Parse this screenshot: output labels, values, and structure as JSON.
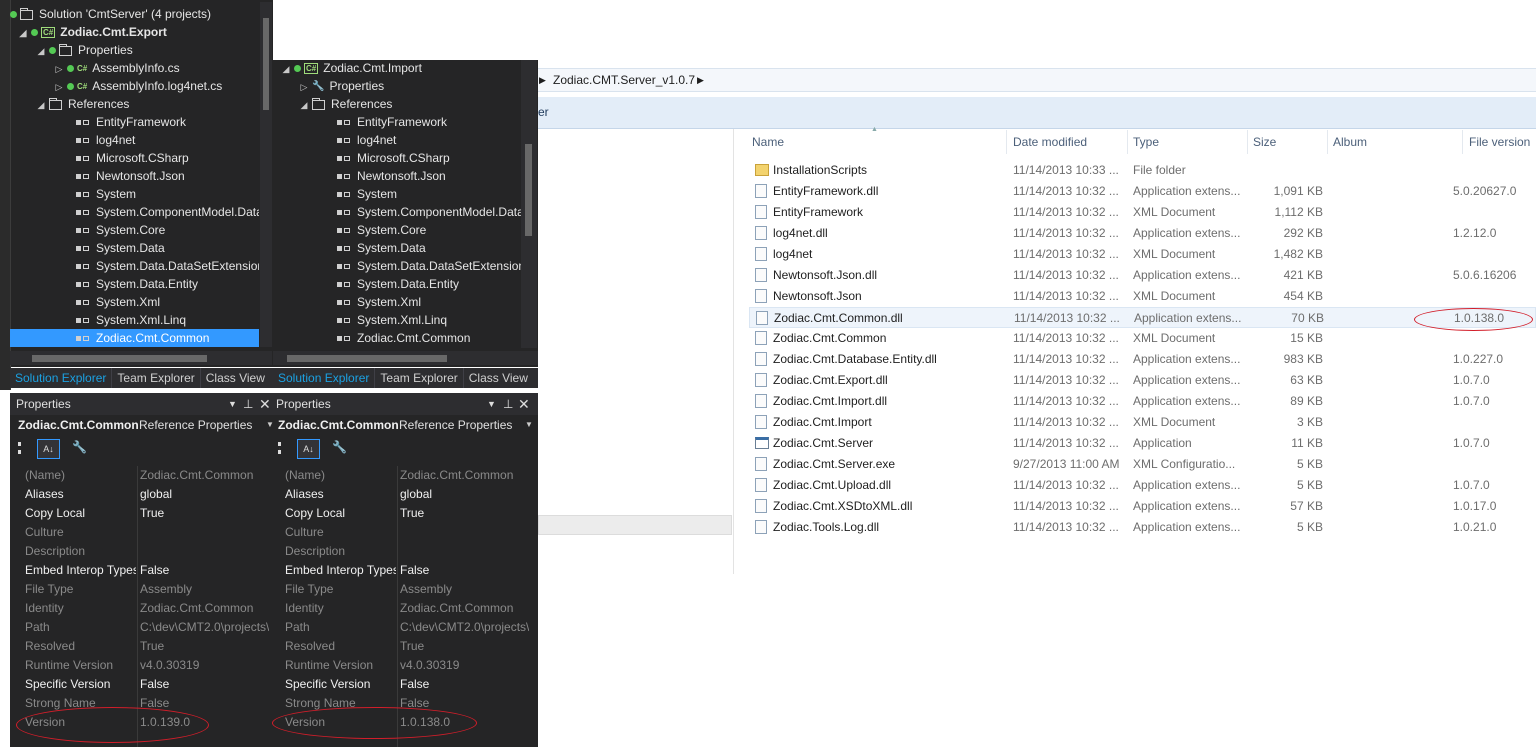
{
  "left_solution": {
    "rows": [
      {
        "text": "Solution 'CmtServer' (4 projects)",
        "icon": "solution-icon"
      },
      {
        "text": "Zodiac.Cmt.Export",
        "icon": "csharp-project-icon"
      },
      {
        "text": "Properties",
        "icon": "properties-folder-icon"
      },
      {
        "text": "AssemblyInfo.cs",
        "icon": "csharp-file-icon"
      },
      {
        "text": "AssemblyInfo.log4net.cs",
        "icon": "csharp-file-icon"
      },
      {
        "text": "References",
        "icon": "references-folder-icon"
      },
      {
        "text": "EntityFramework",
        "icon": "reference-icon"
      },
      {
        "text": "log4net",
        "icon": "reference-icon"
      },
      {
        "text": "Microsoft.CSharp",
        "icon": "reference-icon"
      },
      {
        "text": "Newtonsoft.Json",
        "icon": "reference-icon"
      },
      {
        "text": "System",
        "icon": "reference-icon"
      },
      {
        "text": "System.ComponentModel.DataAnnotations",
        "icon": "reference-icon"
      },
      {
        "text": "System.Core",
        "icon": "reference-icon"
      },
      {
        "text": "System.Data",
        "icon": "reference-icon"
      },
      {
        "text": "System.Data.DataSetExtensions",
        "icon": "reference-icon"
      },
      {
        "text": "System.Data.Entity",
        "icon": "reference-icon"
      },
      {
        "text": "System.Xml",
        "icon": "reference-icon"
      },
      {
        "text": "System.Xml.Linq",
        "icon": "reference-icon"
      },
      {
        "text": "Zodiac.Cmt.Common",
        "icon": "reference-icon"
      }
    ],
    "tabs": [
      "Solution Explorer",
      "Team Explorer",
      "Class View"
    ]
  },
  "right_solution": {
    "rows": [
      {
        "text": "Zodiac.Cmt.Import",
        "icon": "csharp-project-icon"
      },
      {
        "text": "Properties",
        "icon": "wrench-icon"
      },
      {
        "text": "References",
        "icon": "references-folder-icon"
      },
      {
        "text": "EntityFramework",
        "icon": "reference-icon"
      },
      {
        "text": "log4net",
        "icon": "reference-icon"
      },
      {
        "text": "Microsoft.CSharp",
        "icon": "reference-icon"
      },
      {
        "text": "Newtonsoft.Json",
        "icon": "reference-icon"
      },
      {
        "text": "System",
        "icon": "reference-icon"
      },
      {
        "text": "System.ComponentModel.DataAnnotations",
        "icon": "reference-icon"
      },
      {
        "text": "System.Core",
        "icon": "reference-icon"
      },
      {
        "text": "System.Data",
        "icon": "reference-icon"
      },
      {
        "text": "System.Data.DataSetExtensions",
        "icon": "reference-icon"
      },
      {
        "text": "System.Data.Entity",
        "icon": "reference-icon"
      },
      {
        "text": "System.Xml",
        "icon": "reference-icon"
      },
      {
        "text": "System.Xml.Linq",
        "icon": "reference-icon"
      },
      {
        "text": "Zodiac.Cmt.Common",
        "icon": "reference-icon"
      }
    ],
    "tabs": [
      "Solution Explorer",
      "Team Explorer",
      "Class View"
    ]
  },
  "left_props": {
    "title": "Properties",
    "object_name": "Zodiac.Cmt.Common",
    "object_type": "Reference Properties",
    "rows": [
      {
        "name": "(Name)",
        "value": "Zodiac.Cmt.Common",
        "enabled": false
      },
      {
        "name": "Aliases",
        "value": "global",
        "enabled": true
      },
      {
        "name": "Copy Local",
        "value": "True",
        "enabled": true
      },
      {
        "name": "Culture",
        "value": "",
        "enabled": false
      },
      {
        "name": "Description",
        "value": "",
        "enabled": false
      },
      {
        "name": "Embed Interop Types",
        "value": "False",
        "enabled": true
      },
      {
        "name": "File Type",
        "value": "Assembly",
        "enabled": false
      },
      {
        "name": "Identity",
        "value": "Zodiac.Cmt.Common",
        "enabled": false
      },
      {
        "name": "Path",
        "value": "C:\\dev\\CMT2.0\\projects\\",
        "enabled": false
      },
      {
        "name": "Resolved",
        "value": "True",
        "enabled": false
      },
      {
        "name": "Runtime Version",
        "value": "v4.0.30319",
        "enabled": false
      },
      {
        "name": "Specific Version",
        "value": "False",
        "enabled": true
      },
      {
        "name": "Strong Name",
        "value": "False",
        "enabled": false
      },
      {
        "name": "Version",
        "value": "1.0.139.0",
        "enabled": false
      }
    ]
  },
  "right_props": {
    "title": "Properties",
    "object_name": "Zodiac.Cmt.Common",
    "object_type": "Reference Properties",
    "rows": [
      {
        "name": "(Name)",
        "value": "Zodiac.Cmt.Common",
        "enabled": false
      },
      {
        "name": "Aliases",
        "value": "global",
        "enabled": true
      },
      {
        "name": "Copy Local",
        "value": "True",
        "enabled": true
      },
      {
        "name": "Culture",
        "value": "",
        "enabled": false
      },
      {
        "name": "Description",
        "value": "",
        "enabled": false
      },
      {
        "name": "Embed Interop Types",
        "value": "False",
        "enabled": true
      },
      {
        "name": "File Type",
        "value": "Assembly",
        "enabled": false
      },
      {
        "name": "Identity",
        "value": "Zodiac.Cmt.Common",
        "enabled": false
      },
      {
        "name": "Path",
        "value": "C:\\dev\\CMT2.0\\projects\\",
        "enabled": false
      },
      {
        "name": "Resolved",
        "value": "True",
        "enabled": false
      },
      {
        "name": "Runtime Version",
        "value": "v4.0.30319",
        "enabled": false
      },
      {
        "name": "Specific Version",
        "value": "False",
        "enabled": true
      },
      {
        "name": "Strong Name",
        "value": "False",
        "enabled": false
      },
      {
        "name": "Version",
        "value": "1.0.138.0",
        "enabled": false
      }
    ]
  },
  "explorer": {
    "breadcrumb": "Zodiac.CMT.Server_v1.0.7",
    "toolbar_fragment": "er",
    "columns": [
      "Name",
      "Date modified",
      "Type",
      "Size",
      "Album",
      "File version"
    ],
    "files": [
      {
        "name": "InstallationScripts",
        "date": "11/14/2013 10:33 ...",
        "type": "File folder",
        "size": "",
        "version": "",
        "icon": "folder-icon"
      },
      {
        "name": "EntityFramework.dll",
        "date": "11/14/2013 10:32 ...",
        "type": "Application extens...",
        "size": "1,091 KB",
        "version": "5.0.20627.0",
        "icon": "dll-icon"
      },
      {
        "name": "EntityFramework",
        "date": "11/14/2013 10:32 ...",
        "type": "XML Document",
        "size": "1,112 KB",
        "version": "",
        "icon": "xml-icon"
      },
      {
        "name": "log4net.dll",
        "date": "11/14/2013 10:32 ...",
        "type": "Application extens...",
        "size": "292 KB",
        "version": "1.2.12.0",
        "icon": "dll-icon"
      },
      {
        "name": "log4net",
        "date": "11/14/2013 10:32 ...",
        "type": "XML Document",
        "size": "1,482 KB",
        "version": "",
        "icon": "xml-icon"
      },
      {
        "name": "Newtonsoft.Json.dll",
        "date": "11/14/2013 10:32 ...",
        "type": "Application extens...",
        "size": "421 KB",
        "version": "5.0.6.16206",
        "icon": "dll-icon"
      },
      {
        "name": "Newtonsoft.Json",
        "date": "11/14/2013 10:32 ...",
        "type": "XML Document",
        "size": "454 KB",
        "version": "",
        "icon": "xml-icon"
      },
      {
        "name": "Zodiac.Cmt.Common.dll",
        "date": "11/14/2013 10:32 ...",
        "type": "Application extens...",
        "size": "70 KB",
        "version": "1.0.138.0",
        "icon": "dll-icon"
      },
      {
        "name": "Zodiac.Cmt.Common",
        "date": "11/14/2013 10:32 ...",
        "type": "XML Document",
        "size": "15 KB",
        "version": "",
        "icon": "xml-icon"
      },
      {
        "name": "Zodiac.Cmt.Database.Entity.dll",
        "date": "11/14/2013 10:32 ...",
        "type": "Application extens...",
        "size": "983 KB",
        "version": "1.0.227.0",
        "icon": "dll-icon"
      },
      {
        "name": "Zodiac.Cmt.Export.dll",
        "date": "11/14/2013 10:32 ...",
        "type": "Application extens...",
        "size": "63 KB",
        "version": "1.0.7.0",
        "icon": "dll-icon"
      },
      {
        "name": "Zodiac.Cmt.Import.dll",
        "date": "11/14/2013 10:32 ...",
        "type": "Application extens...",
        "size": "89 KB",
        "version": "1.0.7.0",
        "icon": "dll-icon"
      },
      {
        "name": "Zodiac.Cmt.Import",
        "date": "11/14/2013 10:32 ...",
        "type": "XML Document",
        "size": "3 KB",
        "version": "",
        "icon": "xml-icon"
      },
      {
        "name": "Zodiac.Cmt.Server",
        "date": "11/14/2013 10:32 ...",
        "type": "Application",
        "size": "11 KB",
        "version": "1.0.7.0",
        "icon": "application-icon"
      },
      {
        "name": "Zodiac.Cmt.Server.exe",
        "date": "9/27/2013 11:00 AM",
        "type": "XML Configuratio...",
        "size": "5 KB",
        "version": "",
        "icon": "config-icon"
      },
      {
        "name": "Zodiac.Cmt.Upload.dll",
        "date": "11/14/2013 10:32 ...",
        "type": "Application extens...",
        "size": "5 KB",
        "version": "1.0.7.0",
        "icon": "dll-icon"
      },
      {
        "name": "Zodiac.Cmt.XSDtoXML.dll",
        "date": "11/14/2013 10:32 ...",
        "type": "Application extens...",
        "size": "57 KB",
        "version": "1.0.17.0",
        "icon": "dll-icon"
      },
      {
        "name": "Zodiac.Tools.Log.dll",
        "date": "11/14/2013 10:32 ...",
        "type": "Application extens...",
        "size": "5 KB",
        "version": "1.0.21.0",
        "icon": "dll-icon"
      }
    ]
  },
  "colors": {
    "vs_background": "#252526",
    "selection": "#3399ff",
    "tab_active": "#1ba1e2",
    "annotation_red": "#d21e2a"
  }
}
